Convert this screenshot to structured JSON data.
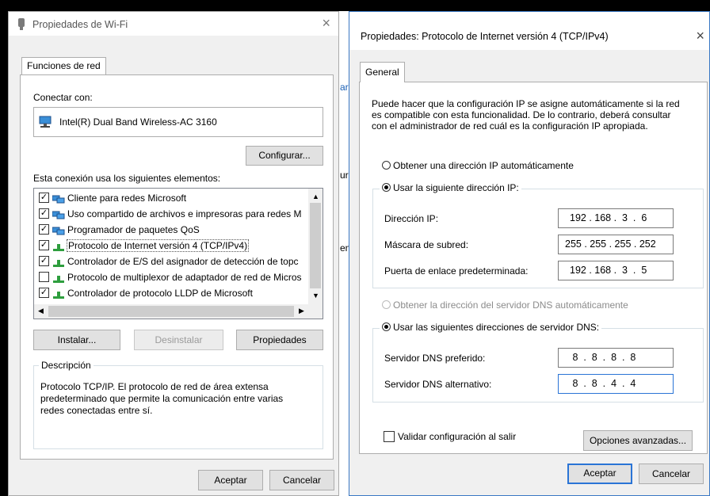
{
  "wifi_dialog": {
    "title": "Propiedades de Wi-Fi",
    "close": "×",
    "tab": "Funciones de red",
    "connect_label": "Conectar con:",
    "adapter": "Intel(R) Dual Band Wireless-AC 3160",
    "configure_button": "Configurar...",
    "elements_label": "Esta conexión usa los siguientes elementos:",
    "items": [
      {
        "label": "Cliente para redes Microsoft",
        "checked": "✓"
      },
      {
        "label": "Uso compartido de archivos e impresoras para redes M",
        "checked": "✓"
      },
      {
        "label": "Programador de paquetes QoS",
        "checked": "✓"
      },
      {
        "label": "Protocolo de Internet versión 4 (TCP/IPv4)",
        "checked": "✓"
      },
      {
        "label": "Controlador de E/S del asignador de detección de topc",
        "checked": "✓"
      },
      {
        "label": "Protocolo de multiplexor de adaptador de red de Micros",
        "checked": ""
      },
      {
        "label": "Controlador de protocolo LLDP de Microsoft",
        "checked": "✓"
      }
    ],
    "install_button": "Instalar...",
    "uninstall_button": "Desinstalar",
    "properties_button": "Propiedades",
    "description_legend": "Descripción",
    "description_text": "Protocolo TCP/IP. El protocolo de red de área extensa predeterminado que permite la comunicación entre varias redes conectadas entre sí.",
    "accept_button": "Aceptar",
    "cancel_button": "Cancelar",
    "background_fragments": [
      "ar",
      "ur",
      "en"
    ]
  },
  "ipv4_dialog": {
    "title": "Propiedades: Protocolo de Internet versión 4 (TCP/IPv4)",
    "close": "×",
    "tab": "General",
    "intro": "Puede hacer que la configuración IP se asigne automáticamente si la red es compatible con esta funcionalidad. De lo contrario, deberá consultar con el administrador de red cuál es la configuración IP apropiada.",
    "auto_ip_option": "Obtener una dirección IP automáticamente",
    "manual_ip_option": "Usar la siguiente dirección IP:",
    "ip_label": "Dirección IP:",
    "ip_value": "192 . 168 .  3  .  6",
    "mask_label": "Máscara de subred:",
    "mask_value": "255 . 255 . 255 . 252",
    "gateway_label": "Puerta de enlace predeterminada:",
    "gateway_value": "192 . 168 .  3  .  5",
    "auto_dns_option": "Obtener la dirección del servidor DNS automáticamente",
    "manual_dns_option": "Usar las siguientes direcciones de servidor DNS:",
    "preferred_dns_label": "Servidor DNS preferido:",
    "preferred_dns_value": " 8  .  8  .  8  .  8",
    "alternate_dns_label": "Servidor DNS alternativo:",
    "alternate_dns_value": " 8  .  8  .  4  .  4",
    "validate_label": "Validar configuración al salir",
    "advanced_button": "Opciones avanzadas...",
    "accept_button": "Aceptar",
    "cancel_button": "Cancelar"
  }
}
